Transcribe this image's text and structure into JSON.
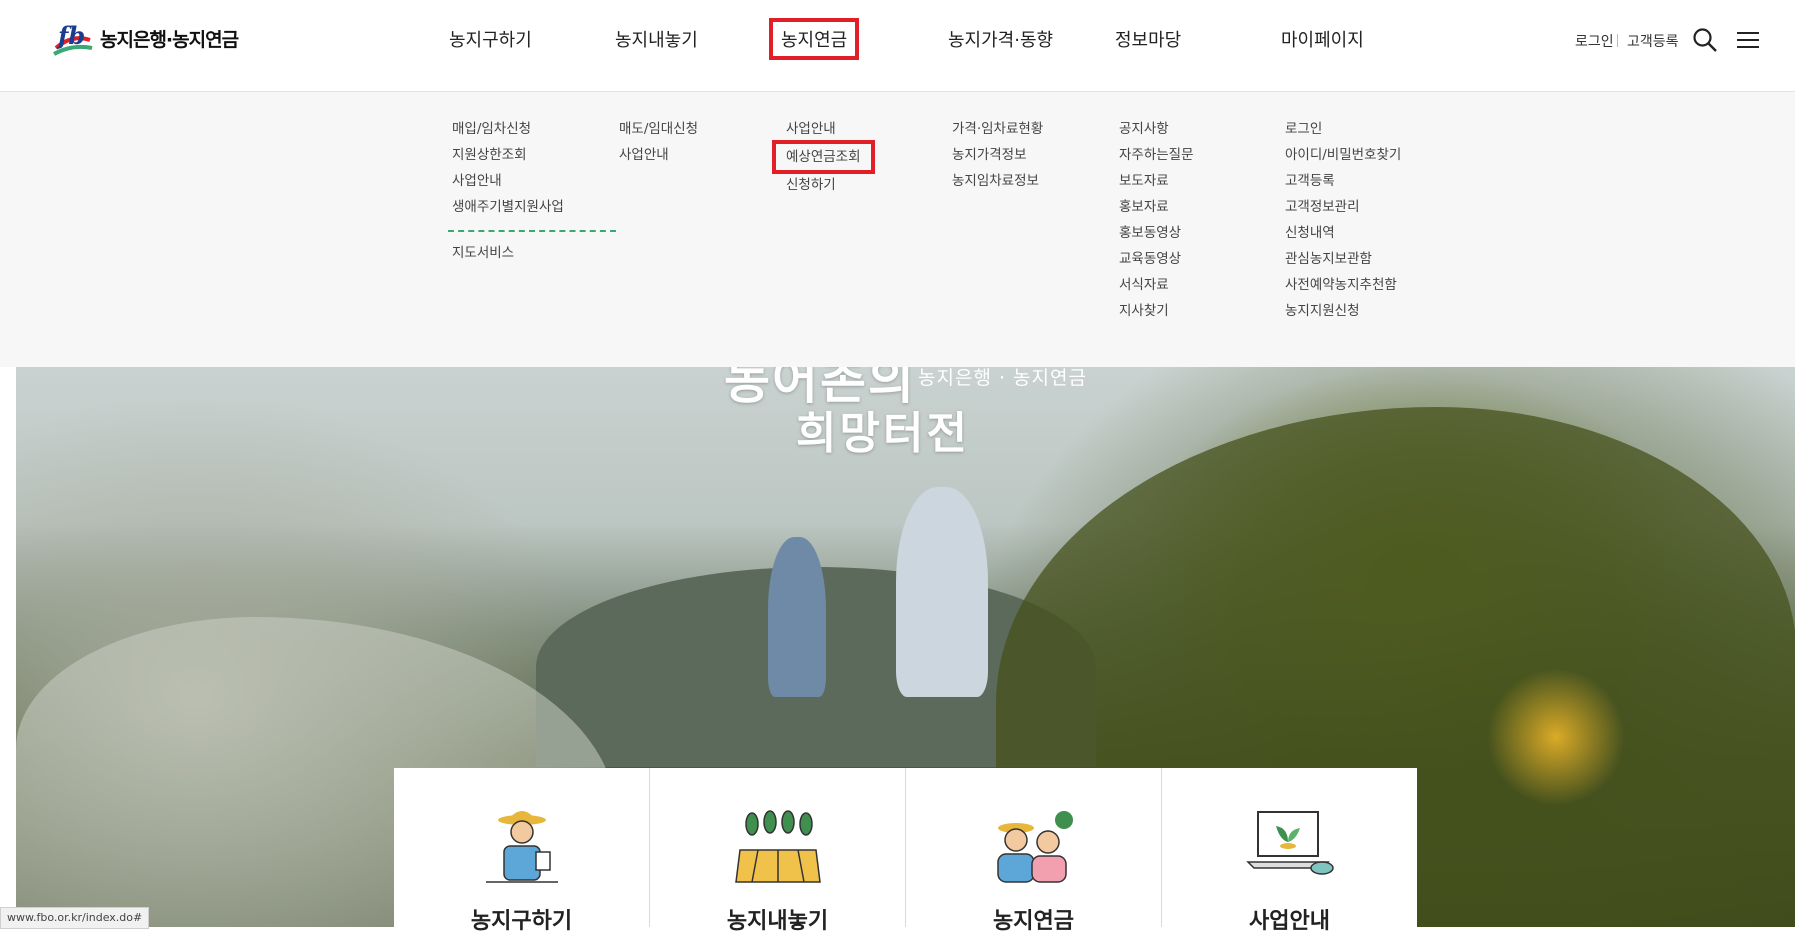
{
  "logo": {
    "text": "농지은행·농지연금",
    "mark": "fb-logo-icon"
  },
  "gnb": [
    {
      "label": "농지구하기"
    },
    {
      "label": "농지내놓기"
    },
    {
      "label": "농지연금"
    },
    {
      "label": "농지가격·동향"
    },
    {
      "label": "정보마당"
    },
    {
      "label": "마이페이지"
    }
  ],
  "util": {
    "login": "로그인",
    "register": "고객등록"
  },
  "icons": {
    "search": "search-icon",
    "menu": "hamburger-menu-icon"
  },
  "menu": {
    "col1": [
      "매입/임차신청",
      "지원상한조회",
      "사업안내",
      "생애주기별지원사업",
      "지도서비스"
    ],
    "col2": [
      "매도/임대신청",
      "사업안내"
    ],
    "col3": [
      "사업안내",
      "예상연금조회",
      "신청하기"
    ],
    "col4": [
      "가격·임차료현황",
      "농지가격정보",
      "농지임차료정보"
    ],
    "col5": [
      "공지사항",
      "자주하는질문",
      "보도자료",
      "홍보자료",
      "홍보동영상",
      "교육동영상",
      "서식자료",
      "지사찾기"
    ],
    "col6": [
      "로그인",
      "아이디/비밀번호찾기",
      "고객등록",
      "고객정보관리",
      "신청내역",
      "관심농지보관함",
      "사전예약농지추천함",
      "농지지원신청"
    ]
  },
  "hero": {
    "title_line1": "농어촌의",
    "title_line2": "희망터전",
    "subtitle": "농지은행 · 농지연금"
  },
  "cards": [
    {
      "label": "농지구하기",
      "icon": "farmer-icon"
    },
    {
      "label": "농지내놓기",
      "icon": "farmland-icon"
    },
    {
      "label": "농지연금",
      "icon": "elderly-couple-icon"
    },
    {
      "label": "사업안내",
      "icon": "laptop-sprout-icon"
    }
  ],
  "status_bar": {
    "url": "www.fbo.or.kr/index.do#"
  },
  "colors": {
    "highlight": "#e11f26",
    "accent_green": "#3aa872",
    "brand_blue": "#1a3d8f"
  }
}
